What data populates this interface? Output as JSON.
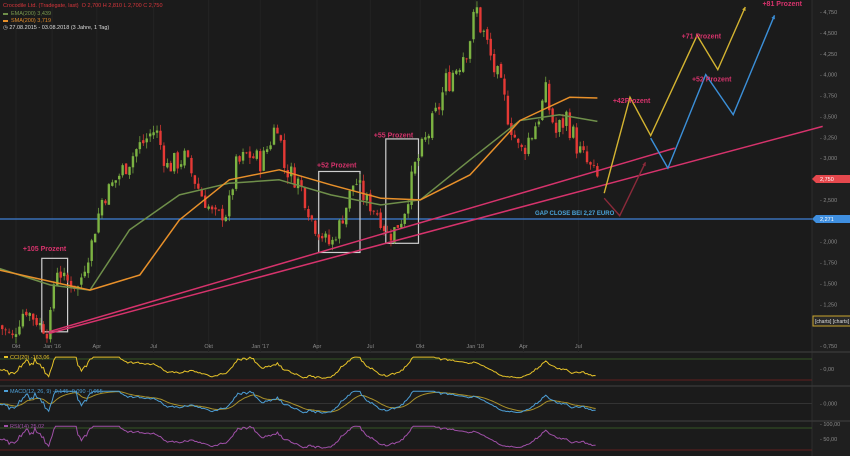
{
  "header": {
    "instrument": "Crocodile Ltd. (Tradegate, last)",
    "ohlc": "O 2,700  H 2,810  L 2,700  C 2,750",
    "ma1": "EMA(200)  3,439",
    "ma2": "SMA(200)  3,719",
    "range": "27.08.2015 - 03.08.2018  (3 Jahre, 1 Tag)"
  },
  "colors": {
    "background": "#1b1b1b",
    "up": "#7cb342",
    "down": "#e53935",
    "ma1": "#6f8f4a",
    "ma2": "#e8902a",
    "trend": "#d6336c",
    "gap": "#3f7fd6",
    "proj_yellow": "#d4b431",
    "proj_blue": "#3b8fd8",
    "proj_red": "#8a2a3a",
    "annotation": "#d6336c"
  },
  "chart_data": {
    "type": "line",
    "title": "Crocodile Ltd. (Tradegate, last)",
    "x_unit": "months since Sep 2015",
    "xlim": [
      -0.2,
      47.3
    ],
    "ylim": [
      0.5,
      4.9
    ],
    "yticks": [
      "4,750",
      "4,500",
      "4,250",
      "4,000",
      "3,750",
      "3,500",
      "3,250",
      "3,000",
      "2,500",
      "2,000",
      "1,750",
      "1,500",
      "1,250",
      "0,750"
    ],
    "ytick_values": [
      4.75,
      4.5,
      4.25,
      4.0,
      3.75,
      3.5,
      3.25,
      3.0,
      2.5,
      2.0,
      1.75,
      1.5,
      1.25,
      0.75
    ],
    "xticks": [
      {
        "m": 1,
        "label": "Okt"
      },
      {
        "m": 3.1,
        "label": "Jan '16"
      },
      {
        "m": 5.7,
        "label": "Apr"
      },
      {
        "m": 9,
        "label": "Jul"
      },
      {
        "m": 12.2,
        "label": "Okt"
      },
      {
        "m": 15.2,
        "label": "Jan '17"
      },
      {
        "m": 18.5,
        "label": "Apr"
      },
      {
        "m": 21.6,
        "label": "Jul"
      },
      {
        "m": 24.5,
        "label": "Okt"
      },
      {
        "m": 27.7,
        "label": "Jan '18"
      },
      {
        "m": 30.5,
        "label": "Apr"
      },
      {
        "m": 33.7,
        "label": "Jul"
      }
    ],
    "price_keypoints": [
      [
        0,
        1.0
      ],
      [
        0.8,
        0.85
      ],
      [
        1.5,
        1.2
      ],
      [
        2.2,
        1.05
      ],
      [
        2.9,
        0.9
      ],
      [
        3.3,
        1.7
      ],
      [
        3.8,
        1.55
      ],
      [
        4.6,
        1.45
      ],
      [
        5.3,
        1.9
      ],
      [
        6,
        2.5
      ],
      [
        7,
        2.8
      ],
      [
        8,
        3.1
      ],
      [
        9.1,
        3.35
      ],
      [
        9.8,
        2.9
      ],
      [
        10.8,
        3.0
      ],
      [
        11.7,
        2.6
      ],
      [
        12.5,
        2.3
      ],
      [
        13.3,
        2.35
      ],
      [
        13.8,
        2.9
      ],
      [
        14.5,
        3.05
      ],
      [
        15.3,
        2.95
      ],
      [
        16.2,
        3.45
      ],
      [
        16.6,
        2.9
      ],
      [
        17.5,
        2.7
      ],
      [
        18.3,
        2.2
      ],
      [
        19.3,
        1.95
      ],
      [
        20,
        2.3
      ],
      [
        20.7,
        2.75
      ],
      [
        21.3,
        2.5
      ],
      [
        22,
        2.35
      ],
      [
        22.7,
        2.05
      ],
      [
        23.5,
        2.3
      ],
      [
        24.2,
        2.9
      ],
      [
        24.8,
        3.2
      ],
      [
        25.4,
        3.5
      ],
      [
        26,
        3.9
      ],
      [
        26.6,
        4.1
      ],
      [
        27.3,
        4.4
      ],
      [
        27.8,
        4.75
      ],
      [
        28.3,
        4.4
      ],
      [
        28.9,
        4.0
      ],
      [
        29.5,
        3.6
      ],
      [
        30.3,
        3.05
      ],
      [
        31,
        3.3
      ],
      [
        31.8,
        3.75
      ],
      [
        32.4,
        3.3
      ],
      [
        33,
        3.5
      ],
      [
        33.7,
        3.1
      ],
      [
        34.3,
        2.9
      ],
      [
        34.8,
        2.75
      ]
    ],
    "series": [
      {
        "name": "EMA(200)",
        "value": "3,439",
        "points": [
          [
            0,
            1.68
          ],
          [
            3,
            1.48
          ],
          [
            5.3,
            1.42
          ],
          [
            7.6,
            2.14
          ],
          [
            10.5,
            2.56
          ],
          [
            13.4,
            2.7
          ],
          [
            16.3,
            2.74
          ],
          [
            19.3,
            2.56
          ],
          [
            22.2,
            2.44
          ],
          [
            24.5,
            2.5
          ],
          [
            27.4,
            2.98
          ],
          [
            30.3,
            3.45
          ],
          [
            32.6,
            3.52
          ],
          [
            34.8,
            3.44
          ]
        ]
      },
      {
        "name": "SMA(200)",
        "value": "3,719",
        "points": [
          [
            0,
            1.66
          ],
          [
            3.5,
            1.5
          ],
          [
            5.3,
            1.42
          ],
          [
            8.2,
            1.6
          ],
          [
            10.5,
            2.26
          ],
          [
            13.4,
            2.74
          ],
          [
            16.3,
            2.86
          ],
          [
            19.3,
            2.68
          ],
          [
            22.2,
            2.52
          ],
          [
            24.5,
            2.5
          ],
          [
            27.4,
            2.8
          ],
          [
            30.3,
            3.45
          ],
          [
            33.2,
            3.73
          ],
          [
            34.8,
            3.72
          ]
        ]
      }
    ],
    "trendlines": [
      {
        "name": "upper-trendline",
        "from": [
          2.9,
          0.92
        ],
        "to": [
          39.3,
          3.12
        ]
      },
      {
        "name": "lower-trendline",
        "from": [
          2.9,
          0.9
        ],
        "to": [
          47.9,
          3.38
        ]
      }
    ],
    "gap_line": {
      "value": 2.271,
      "label": "GAP CLOSE BEI 2,27 EURO"
    },
    "price_tags": [
      {
        "label": "2,750",
        "value": 2.75,
        "color": "#e5484d"
      },
      {
        "label": "2,271",
        "value": 2.271,
        "color": "#3f8fe0"
      }
    ],
    "projections": [
      {
        "name": "yellow",
        "points": [
          [
            35.2,
            2.58
          ],
          [
            36.7,
            3.73
          ],
          [
            37.9,
            3.27
          ],
          [
            40.6,
            4.47
          ],
          [
            41.8,
            4.06
          ],
          [
            43.4,
            4.81
          ]
        ]
      },
      {
        "name": "blue",
        "points": [
          [
            37.9,
            3.24
          ],
          [
            38.9,
            2.88
          ],
          [
            41.1,
            4.0
          ],
          [
            42.7,
            3.52
          ],
          [
            45.1,
            4.71
          ]
        ]
      },
      {
        "name": "red",
        "points": [
          [
            35.2,
            2.52
          ],
          [
            36.1,
            2.31
          ],
          [
            37.6,
            2.95
          ]
        ]
      }
    ],
    "boxes": [
      {
        "from": [
          2.5,
          0.92
        ],
        "to": [
          4.0,
          1.8
        ]
      },
      {
        "from": [
          18.6,
          1.87
        ],
        "to": [
          21.0,
          2.84
        ]
      },
      {
        "from": [
          22.5,
          1.98
        ],
        "to": [
          24.4,
          3.23
        ]
      }
    ],
    "annotations": [
      {
        "text": "+105 Prozent",
        "m": 1.4,
        "p": 1.89
      },
      {
        "text": "+52 Prozent",
        "m": 18.5,
        "p": 2.89
      },
      {
        "text": "+55 Prozent",
        "m": 21.8,
        "p": 3.25
      },
      {
        "text": "+42Prozent",
        "m": 35.7,
        "p": 3.66
      },
      {
        "text": "+71 Prozent",
        "m": 39.7,
        "p": 4.43
      },
      {
        "text": "+52 Prozent",
        "m": 40.3,
        "p": 3.92
      },
      {
        "text": "+81 Prozent",
        "m": 44.4,
        "p": 4.82
      }
    ]
  },
  "indicators": [
    {
      "name": "CCI(20)",
      "values": "-163,06",
      "axis": [
        "0,00"
      ],
      "color": "#e6c229"
    },
    {
      "name": "MACD(12, 26, 9)",
      "values": "-0,145",
      "extra": [
        "-0,090",
        "-0,055"
      ],
      "axis": [
        "0,000"
      ],
      "color": "#4d9fd6"
    },
    {
      "name": "RSI(14)",
      "values": "25,02",
      "axis": [
        "100,00",
        "50,00"
      ],
      "color": "#a050a8"
    }
  ],
  "watermark": "[charts] [charts]"
}
